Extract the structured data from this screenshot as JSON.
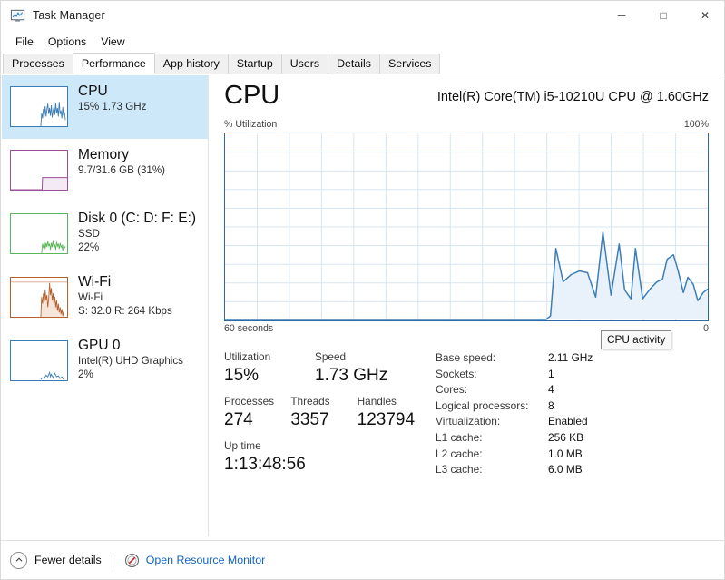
{
  "window": {
    "title": "Task Manager",
    "icon": "task-manager-icon",
    "controls": {
      "minimize": "─",
      "maximize": "□",
      "close": "✕"
    }
  },
  "menu": {
    "items": [
      {
        "label": "File"
      },
      {
        "label": "Options"
      },
      {
        "label": "View"
      }
    ]
  },
  "tabs": {
    "active": "Performance",
    "items": [
      {
        "label": "Processes"
      },
      {
        "label": "Performance"
      },
      {
        "label": "App history"
      },
      {
        "label": "Startup"
      },
      {
        "label": "Users"
      },
      {
        "label": "Details"
      },
      {
        "label": "Services"
      }
    ]
  },
  "sidebar": {
    "items": [
      {
        "name": "CPU",
        "title": "CPU",
        "line2": "15%  1.73 GHz",
        "line3": "",
        "selected": true,
        "color": "#3a7cb5"
      },
      {
        "name": "Memory",
        "title": "Memory",
        "line2": "9.7/31.6 GB (31%)",
        "line3": "",
        "selected": false,
        "color": "#9b4f96"
      },
      {
        "name": "Disk 0",
        "title": "Disk 0 (C: D: F: E:)",
        "line2": "SSD",
        "line3": "22%",
        "selected": false,
        "color": "#5bb55b"
      },
      {
        "name": "Wi-Fi",
        "title": "Wi-Fi",
        "line2": "Wi-Fi",
        "line3": "S: 32.0 R: 264 Kbps",
        "selected": false,
        "color": "#b5612e"
      },
      {
        "name": "GPU 0",
        "title": "GPU 0",
        "line2": "Intel(R) UHD Graphics",
        "line3": "2%",
        "selected": false,
        "color": "#3a7cb5"
      }
    ]
  },
  "main": {
    "title": "CPU",
    "subtitle": "Intel(R) Core(TM) i5-10210U CPU @ 1.60GHz",
    "graph": {
      "axis_label_top_left": "% Utilization",
      "axis_label_top_right": "100%",
      "axis_label_bottom_left": "60 seconds",
      "axis_label_bottom_right": "0",
      "line_color": "#3b7eb8",
      "fill_color": "#e9f2fa",
      "grid_color": "#d7e6f2",
      "border_color": "#2c69a5"
    },
    "tooltip": {
      "text": "CPU activity"
    },
    "stats": [
      {
        "label": "Utilization",
        "value": "15%"
      },
      {
        "label": "Speed",
        "value": "1.73 GHz"
      },
      {
        "label": "Processes",
        "value": "274"
      },
      {
        "label": "Threads",
        "value": "3357"
      },
      {
        "label": "Handles",
        "value": "123794"
      },
      {
        "label": "Up time",
        "value": "1:13:48:56"
      }
    ],
    "info": [
      {
        "label": "Base speed:",
        "value": "2.11 GHz"
      },
      {
        "label": "Sockets:",
        "value": "1"
      },
      {
        "label": "Cores:",
        "value": "4"
      },
      {
        "label": "Logical processors:",
        "value": "8"
      },
      {
        "label": "Virtualization:",
        "value": "Enabled"
      },
      {
        "label": "L1 cache:",
        "value": "256 KB"
      },
      {
        "label": "L2 cache:",
        "value": "1.0 MB"
      },
      {
        "label": "L3 cache:",
        "value": "6.0 MB"
      }
    ]
  },
  "footer": {
    "fewer_details": "Fewer details",
    "resource_monitor": "Open Resource Monitor",
    "link_color": "#1364c4"
  },
  "chart_data": {
    "type": "area",
    "title": "CPU activity",
    "xlabel": "60 seconds",
    "ylabel": "% Utilization",
    "ylim": [
      0,
      100
    ],
    "xlim": [
      60,
      0
    ],
    "grid": true,
    "legend": "none",
    "series": [
      {
        "name": "CPU Utilization",
        "x": [
          60,
          59,
          58,
          57,
          56,
          55,
          54,
          53,
          52,
          51,
          50,
          49,
          48,
          47,
          46,
          45,
          44,
          43,
          42,
          41,
          40,
          39,
          38,
          37,
          36,
          35,
          34,
          33,
          32,
          31,
          30,
          29,
          28,
          27,
          26,
          25,
          24,
          23,
          22,
          21,
          20,
          19,
          18,
          17,
          16,
          15,
          14,
          13,
          12,
          11,
          10,
          9,
          8,
          7,
          6,
          5,
          4,
          3,
          2,
          1,
          0
        ],
        "values": [
          0,
          0,
          0,
          0,
          0,
          0,
          0,
          0,
          0,
          0,
          0,
          0,
          0,
          0,
          0,
          0,
          0,
          0,
          0,
          0,
          0,
          0,
          0,
          0,
          0,
          0,
          0,
          0,
          0,
          0,
          0,
          0,
          0,
          0,
          0,
          0,
          0,
          0,
          0,
          0,
          0,
          2,
          38,
          12,
          24,
          27,
          26,
          16,
          47,
          7,
          36,
          34,
          5,
          9,
          40,
          4,
          9,
          16,
          13,
          17,
          25,
          28,
          21,
          18,
          8,
          11,
          19,
          7,
          12
        ]
      }
    ]
  }
}
